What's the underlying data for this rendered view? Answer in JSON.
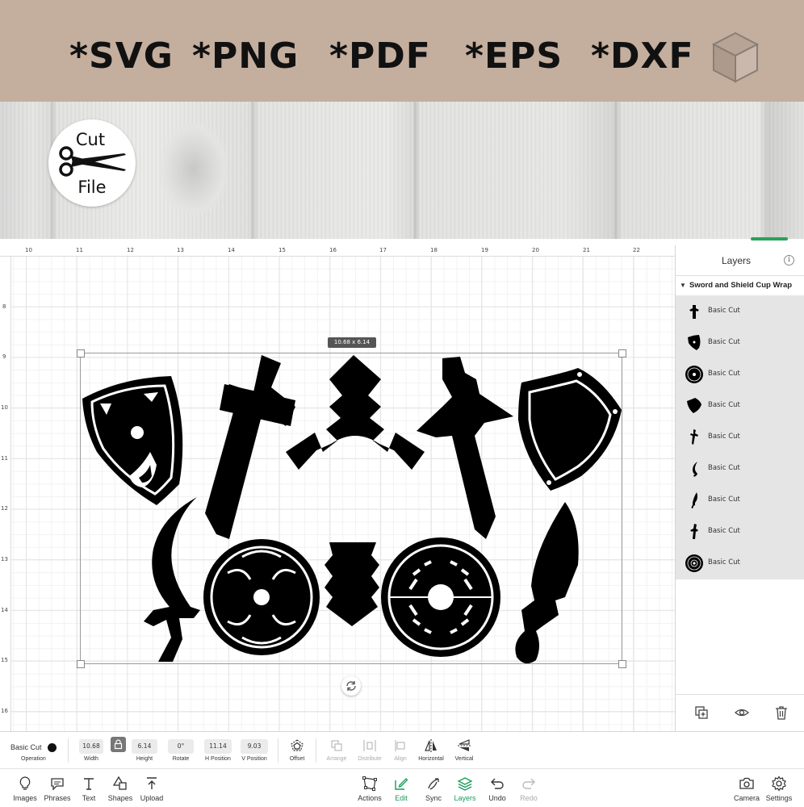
{
  "banner": {
    "formats": [
      "*SVG",
      "*PNG",
      "*PDF",
      "*EPS",
      "*DXF"
    ]
  },
  "badge": {
    "line1": "Cut",
    "line2": "File"
  },
  "ruler": {
    "top_ticks": [
      "10",
      "11",
      "12",
      "13",
      "14",
      "15",
      "16",
      "17",
      "18",
      "19",
      "20",
      "21",
      "22"
    ],
    "left_ticks": [
      "8",
      "9",
      "10",
      "11",
      "12",
      "13",
      "14",
      "15",
      "16"
    ]
  },
  "canvas": {
    "dimensions_label": "10.68 x 6.14"
  },
  "layers_panel": {
    "title": "Layers",
    "group_name": "Sword and Shield Cup Wrap",
    "items": [
      {
        "label": "Basic Cut",
        "icon": "sword-hilt-icon"
      },
      {
        "label": "Basic Cut",
        "icon": "dotted-shield-icon"
      },
      {
        "label": "Basic Cut",
        "icon": "round-shield-icon"
      },
      {
        "label": "Basic Cut",
        "icon": "heater-shield-icon"
      },
      {
        "label": "Basic Cut",
        "icon": "cross-sword-icon"
      },
      {
        "label": "Basic Cut",
        "icon": "scimitar-icon"
      },
      {
        "label": "Basic Cut",
        "icon": "short-sword-icon"
      },
      {
        "label": "Basic Cut",
        "icon": "broadsword-icon"
      },
      {
        "label": "Basic Cut",
        "icon": "ornate-round-shield-icon"
      }
    ]
  },
  "edit_bar": {
    "operation_value": "Basic Cut",
    "operation_label": "Operation",
    "width_value": "10.68",
    "width_label": "Width",
    "height_value": "6.14",
    "height_label": "Height",
    "rotate_value": "0°",
    "rotate_label": "Rotate",
    "hpos_value": "11.14",
    "hpos_label": "H Position",
    "vpos_value": "9.03",
    "vpos_label": "V Position",
    "offset_label": "Offset",
    "arrange_label": "Arrange",
    "distribute_label": "Distribute",
    "align_label": "Align",
    "horizontal_label": "Horizontal",
    "vertical_label": "Vertical"
  },
  "nav": {
    "left": [
      "Images",
      "Phrases",
      "Text",
      "Shapes",
      "Upload"
    ],
    "center": [
      "Actions",
      "Edit",
      "Sync",
      "Layers",
      "Undo",
      "Redo"
    ],
    "right": [
      "Camera",
      "Settings"
    ]
  },
  "colors": {
    "banner": "#c4ae9e",
    "active": "#1a9a5a",
    "layer_list_bg": "#e5e5e5"
  }
}
